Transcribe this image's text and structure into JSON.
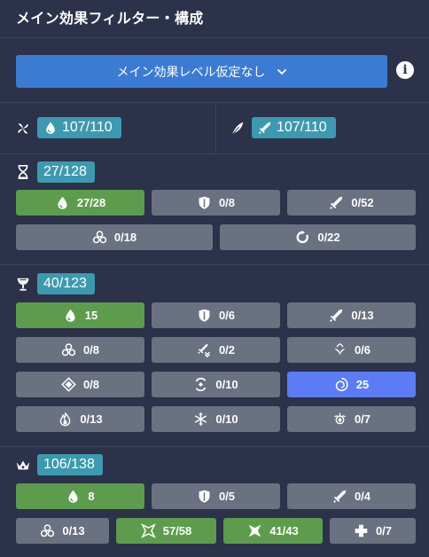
{
  "header": {
    "title": "メイン効果フィルター・構成"
  },
  "main_button": {
    "label": "メイン効果レベル仮定なし"
  },
  "flower": {
    "count": "107/110"
  },
  "plume": {
    "count": "107/110"
  },
  "sands": {
    "count": "27/128",
    "row1": [
      {
        "value": "27/28",
        "icon": "hp-drop-icon",
        "state": "active"
      },
      {
        "value": "0/8",
        "icon": "def-shield-icon",
        "state": "default"
      },
      {
        "value": "0/52",
        "icon": "atk-sword-icon",
        "state": "default"
      }
    ],
    "row2": [
      {
        "value": "0/18",
        "icon": "elemental-mastery-icon",
        "state": "default"
      },
      {
        "value": "0/22",
        "icon": "energy-recharge-icon",
        "state": "default"
      }
    ]
  },
  "goblet": {
    "count": "40/123",
    "rows": [
      [
        {
          "value": "15",
          "icon": "hp-drop-icon",
          "state": "active"
        },
        {
          "value": "0/6",
          "icon": "def-shield-icon",
          "state": "default"
        },
        {
          "value": "0/13",
          "icon": "atk-sword-icon",
          "state": "default"
        }
      ],
      [
        {
          "value": "0/8",
          "icon": "elemental-mastery-icon",
          "state": "default"
        },
        {
          "value": "0/2",
          "icon": "physical-dmg-icon",
          "state": "default"
        },
        {
          "value": "0/6",
          "icon": "anemo-icon",
          "state": "default"
        }
      ],
      [
        {
          "value": "0/8",
          "icon": "geo-icon",
          "state": "default"
        },
        {
          "value": "0/10",
          "icon": "electro-icon",
          "state": "default"
        },
        {
          "value": "25",
          "icon": "hydro-icon",
          "state": "selected"
        }
      ],
      [
        {
          "value": "0/13",
          "icon": "pyro-icon",
          "state": "default"
        },
        {
          "value": "0/10",
          "icon": "cryo-icon",
          "state": "default"
        },
        {
          "value": "0/7",
          "icon": "dendro-icon",
          "state": "default"
        }
      ]
    ]
  },
  "circlet": {
    "count": "106/138",
    "row1": [
      {
        "value": "8",
        "icon": "hp-drop-icon",
        "state": "active"
      },
      {
        "value": "0/5",
        "icon": "def-shield-icon",
        "state": "default"
      },
      {
        "value": "0/4",
        "icon": "atk-sword-icon",
        "state": "default"
      }
    ],
    "row2": [
      {
        "value": "0/13",
        "icon": "elemental-mastery-icon",
        "state": "default"
      },
      {
        "value": "57/58",
        "icon": "crit-rate-icon",
        "state": "active"
      },
      {
        "value": "41/43",
        "icon": "crit-dmg-icon",
        "state": "active"
      },
      {
        "value": "0/7",
        "icon": "healing-bonus-icon",
        "state": "default"
      }
    ]
  },
  "colors": {
    "background": "#2b3249",
    "badge": "#3c9ab0",
    "active": "#5c9c4c",
    "default": "#6a7181",
    "selected": "#5b7cf5",
    "primary": "#3b7bd4"
  }
}
